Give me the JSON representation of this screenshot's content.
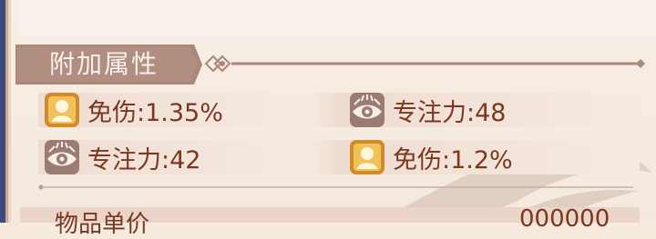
{
  "section": {
    "title": "附加属性"
  },
  "attributes": [
    {
      "icon": "person-portrait-icon",
      "label": "免伤:1.35%"
    },
    {
      "icon": "eye-icon",
      "label": "专注力:48"
    },
    {
      "icon": "eye-icon",
      "label": "专注力:42"
    },
    {
      "icon": "person-portrait-icon",
      "label": "免伤:1.2%"
    }
  ],
  "footer": {
    "label": "物品单价",
    "value": "000000"
  },
  "colors": {
    "panel_bg": "#f5eadd",
    "header_bg": "#a98878",
    "text": "#7a3820",
    "icon_gold": "#d18b2a"
  }
}
